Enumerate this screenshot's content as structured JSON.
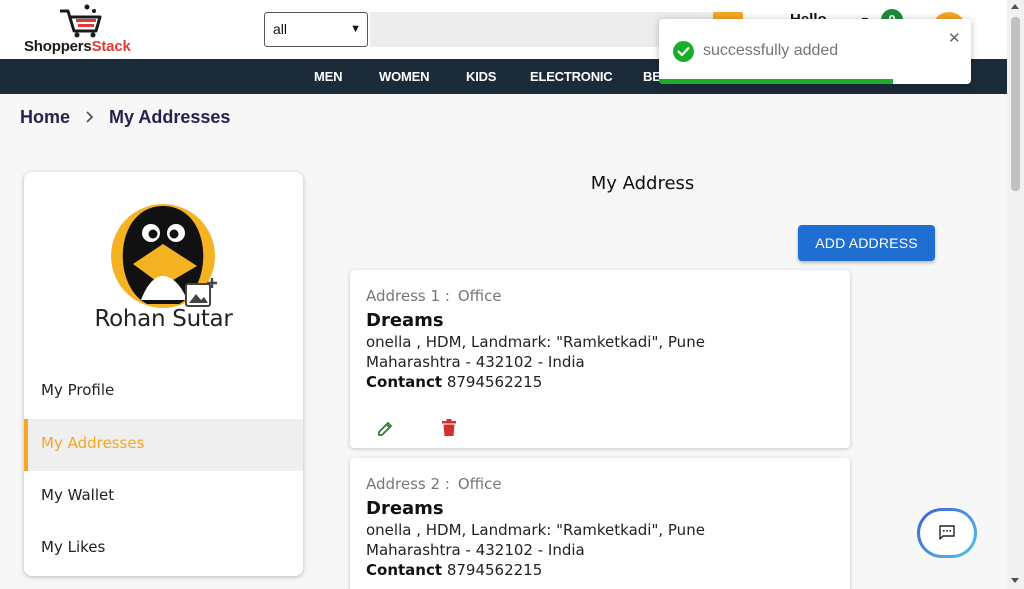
{
  "header": {
    "logo_text_main": "Shoppers",
    "logo_text_accent": "Stack",
    "category_select_value": "all",
    "greeting": "Hello",
    "cart_count": "0"
  },
  "nav": {
    "items": [
      "MEN",
      "WOMEN",
      "KIDS",
      "ELECTRONIC",
      "BE"
    ]
  },
  "breadcrumb": {
    "home": "Home",
    "current": "My Addresses"
  },
  "profile": {
    "name": "Rohan Sutar",
    "menu": [
      {
        "label": "My Profile",
        "active": false
      },
      {
        "label": "My Addresses",
        "active": true
      },
      {
        "label": "My Wallet",
        "active": false
      },
      {
        "label": "My Likes",
        "active": false
      }
    ]
  },
  "main": {
    "title": "My Address",
    "add_button_label": "ADD ADDRESS",
    "addresses": [
      {
        "heading": "Address 1 :",
        "type": "Office",
        "name": "Dreams",
        "line1": "onella , HDM, Landmark: \"Ramketkadi\", Pune",
        "line2": "Maharashtra - 432102 - India",
        "contact_label": "Contanct",
        "contact_value": "8794562215"
      },
      {
        "heading": "Address 2 :",
        "type": "Office",
        "name": "Dreams",
        "line1": "onella , HDM, Landmark: \"Ramketkadi\", Pune",
        "line2": "Maharashtra - 432102 - India",
        "contact_label": "Contanct",
        "contact_value": "8794562215"
      }
    ]
  },
  "toast": {
    "message": "successfully added",
    "close_symbol": "✕",
    "progress_fraction": 0.75
  },
  "colors": {
    "accent": "#f5a623",
    "nav_bg": "#1c2b3a",
    "primary_button": "#1e6fd1",
    "success": "#1aad2a",
    "delete": "#d32f2f",
    "edit": "#2e7d32"
  },
  "icons": {
    "cart": "shopping-cart-icon",
    "chevron": "chevron-right-icon",
    "add_photo": "add-photo-icon",
    "edit": "edit-pencil-icon",
    "delete": "delete-trash-icon",
    "check": "check-circle-icon",
    "chat": "chat-icon"
  }
}
